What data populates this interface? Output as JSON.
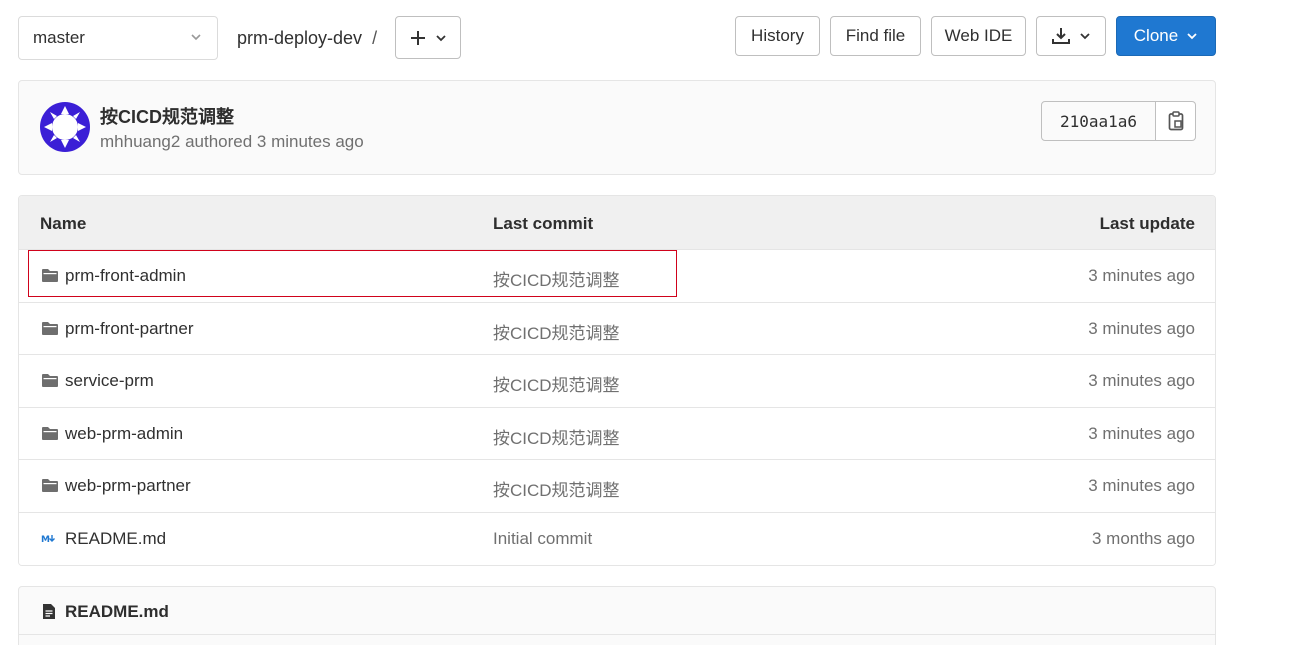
{
  "toolbar": {
    "branch": "master",
    "project": "prm-deploy-dev",
    "separator": "/",
    "history_label": "History",
    "find_file_label": "Find file",
    "web_ide_label": "Web IDE",
    "clone_label": "Clone"
  },
  "last_commit": {
    "title": "按CICD规范调整",
    "meta": "mhhuang2 authored 3 minutes ago",
    "sha": "210aa1a6",
    "avatar_color": "#3b1fd6"
  },
  "table": {
    "headers": {
      "name": "Name",
      "last_commit": "Last commit",
      "last_update": "Last update"
    },
    "rows": [
      {
        "icon": "folder-icon",
        "name": "prm-front-admin",
        "commit": "按CICD规范调整",
        "updated": "3 minutes ago"
      },
      {
        "icon": "folder-icon",
        "name": "prm-front-partner",
        "commit": "按CICD规范调整",
        "updated": "3 minutes ago"
      },
      {
        "icon": "folder-icon",
        "name": "service-prm",
        "commit": "按CICD规范调整",
        "updated": "3 minutes ago"
      },
      {
        "icon": "folder-icon",
        "name": "web-prm-admin",
        "commit": "按CICD规范调整",
        "updated": "3 minutes ago"
      },
      {
        "icon": "folder-icon",
        "name": "web-prm-partner",
        "commit": "按CICD规范调整",
        "updated": "3 minutes ago"
      },
      {
        "icon": "markdown-icon",
        "name": "README.md",
        "commit": "Initial commit",
        "updated": "3 months ago"
      }
    ]
  },
  "readme": {
    "title": "README.md"
  },
  "colors": {
    "accent": "#1f78d1",
    "highlight": "#d0021b"
  }
}
